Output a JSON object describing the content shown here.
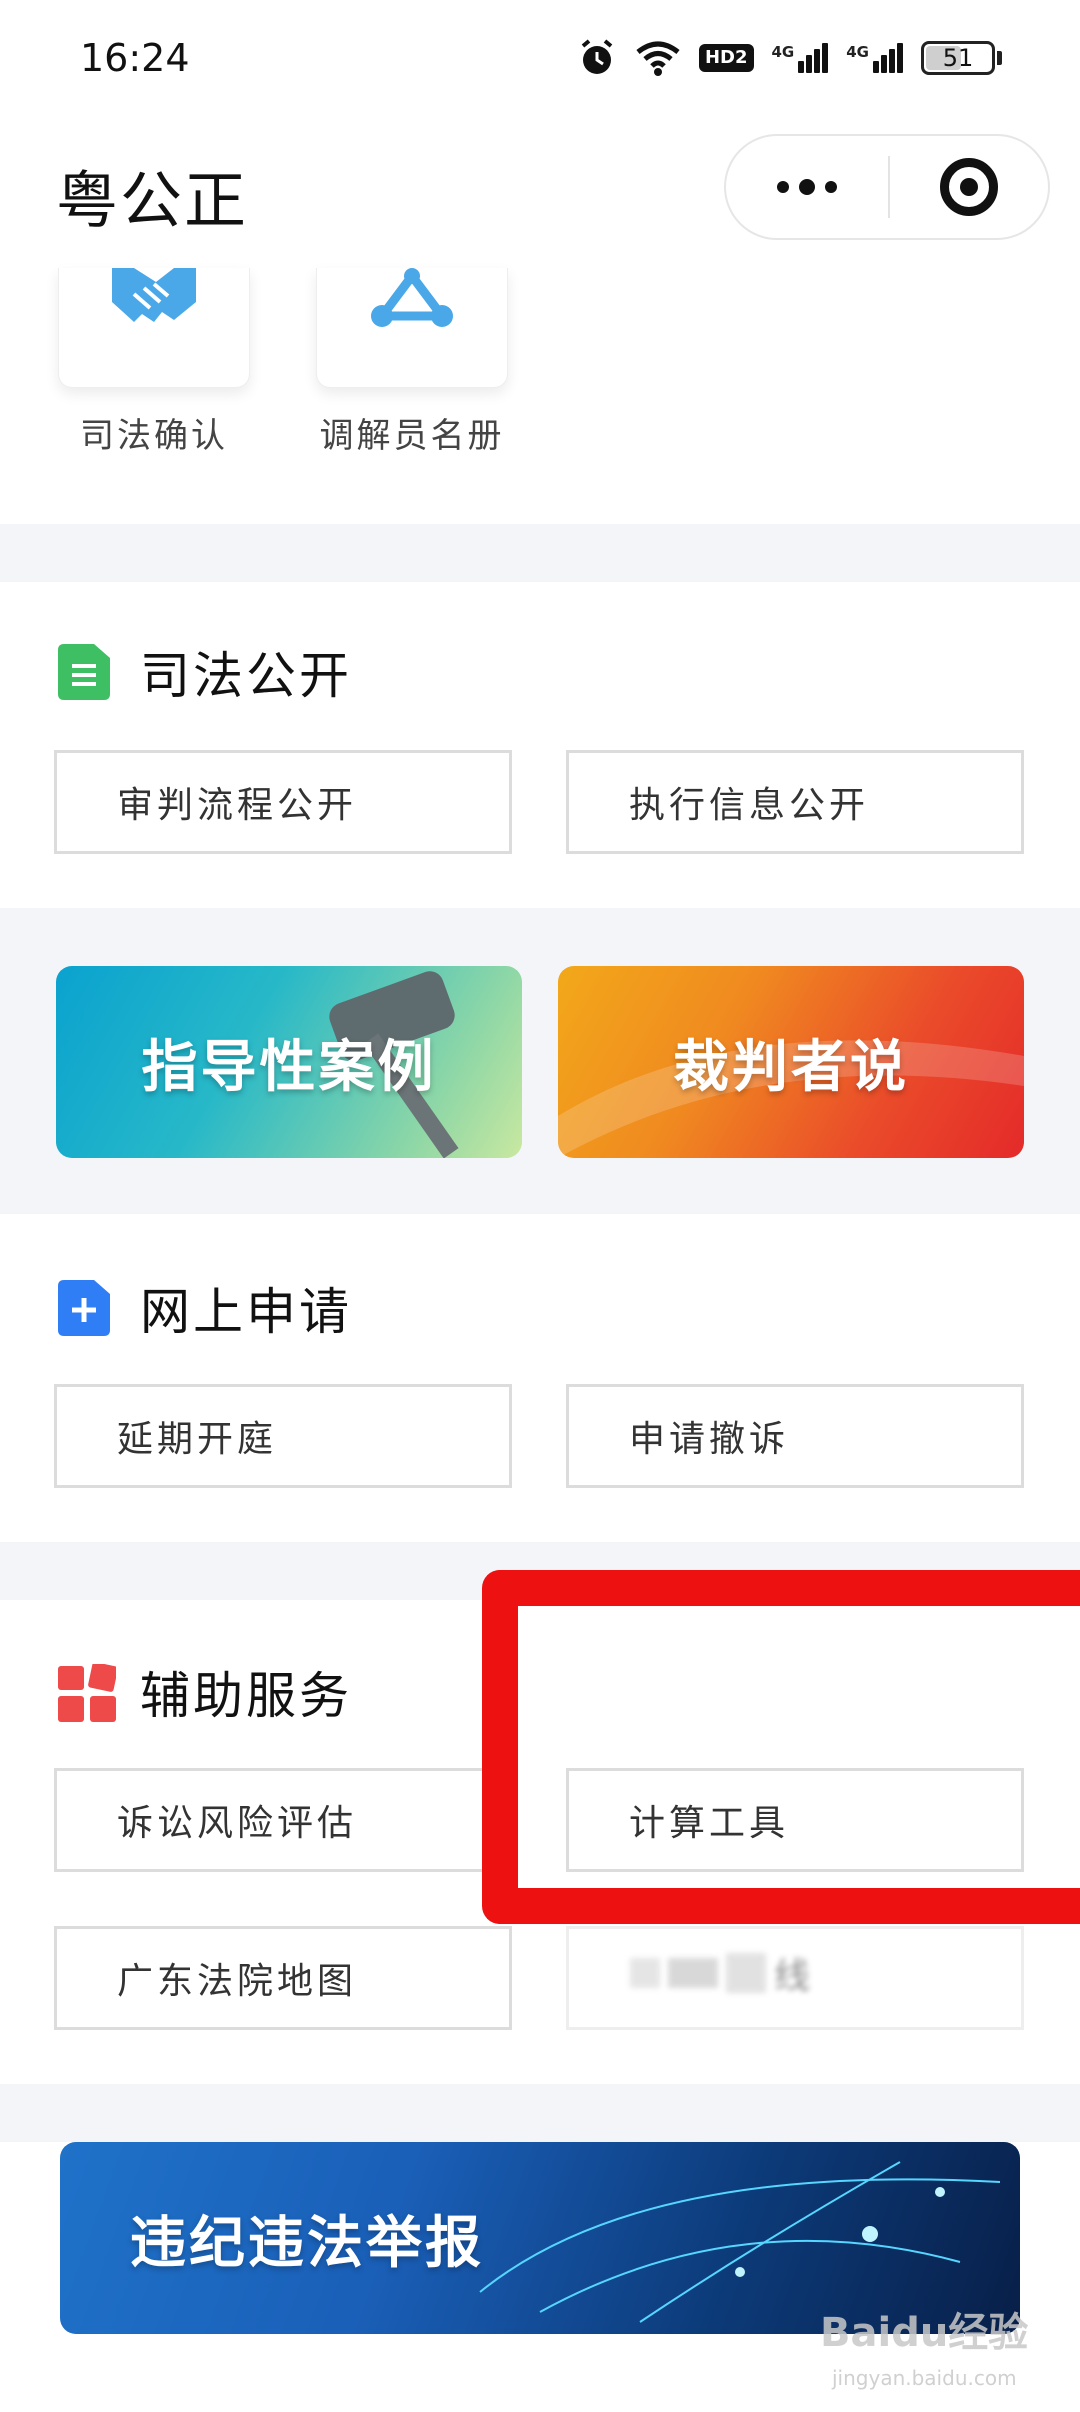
{
  "status_bar": {
    "time": "16:24",
    "hd_label": "HD2",
    "network_1": "4G",
    "network_2": "4G",
    "battery": "51"
  },
  "header": {
    "title": "粤公正",
    "more_icon": "more-dots-icon",
    "close_icon": "target-close-icon"
  },
  "top_tiles": [
    {
      "label": "司法确认",
      "icon": "handshake-icon",
      "color": "#4aa8e8"
    },
    {
      "label": "调解员名册",
      "icon": "network-triangle-icon",
      "color": "#4aa8e8"
    }
  ],
  "sections": {
    "judicial_open": {
      "title": "司法公开",
      "icon": "document-icon",
      "icon_color": "#3fbf64",
      "items": [
        "审判流程公开",
        "执行信息公开"
      ]
    },
    "banners_1": [
      {
        "label": "指导性案例",
        "colors": [
          "#12a3c8",
          "#7fd0a8"
        ]
      },
      {
        "label": "裁判者说",
        "colors": [
          "#f0a018",
          "#e8382c"
        ]
      }
    ],
    "online_apply": {
      "title": "网上申请",
      "icon": "plus-square-icon",
      "icon_color": "#2f7ef5",
      "items": [
        "延期开庭",
        "申请撤诉"
      ]
    },
    "aux_services": {
      "title": "辅助服务",
      "icon": "grid-blocks-icon",
      "icon_color": "#ee4a4a",
      "items": [
        "诉讼风险评估",
        "计算工具",
        "广东法院地图"
      ],
      "blurred_item_tail": "线"
    },
    "report_banner": {
      "label": "违纪违法举报",
      "colors": [
        "#1a5fb8",
        "#0b2a5c"
      ]
    }
  },
  "highlight_color": "#ee1111",
  "watermark": {
    "text": "Baidu经验",
    "sub": "jingyan.baidu.com"
  }
}
